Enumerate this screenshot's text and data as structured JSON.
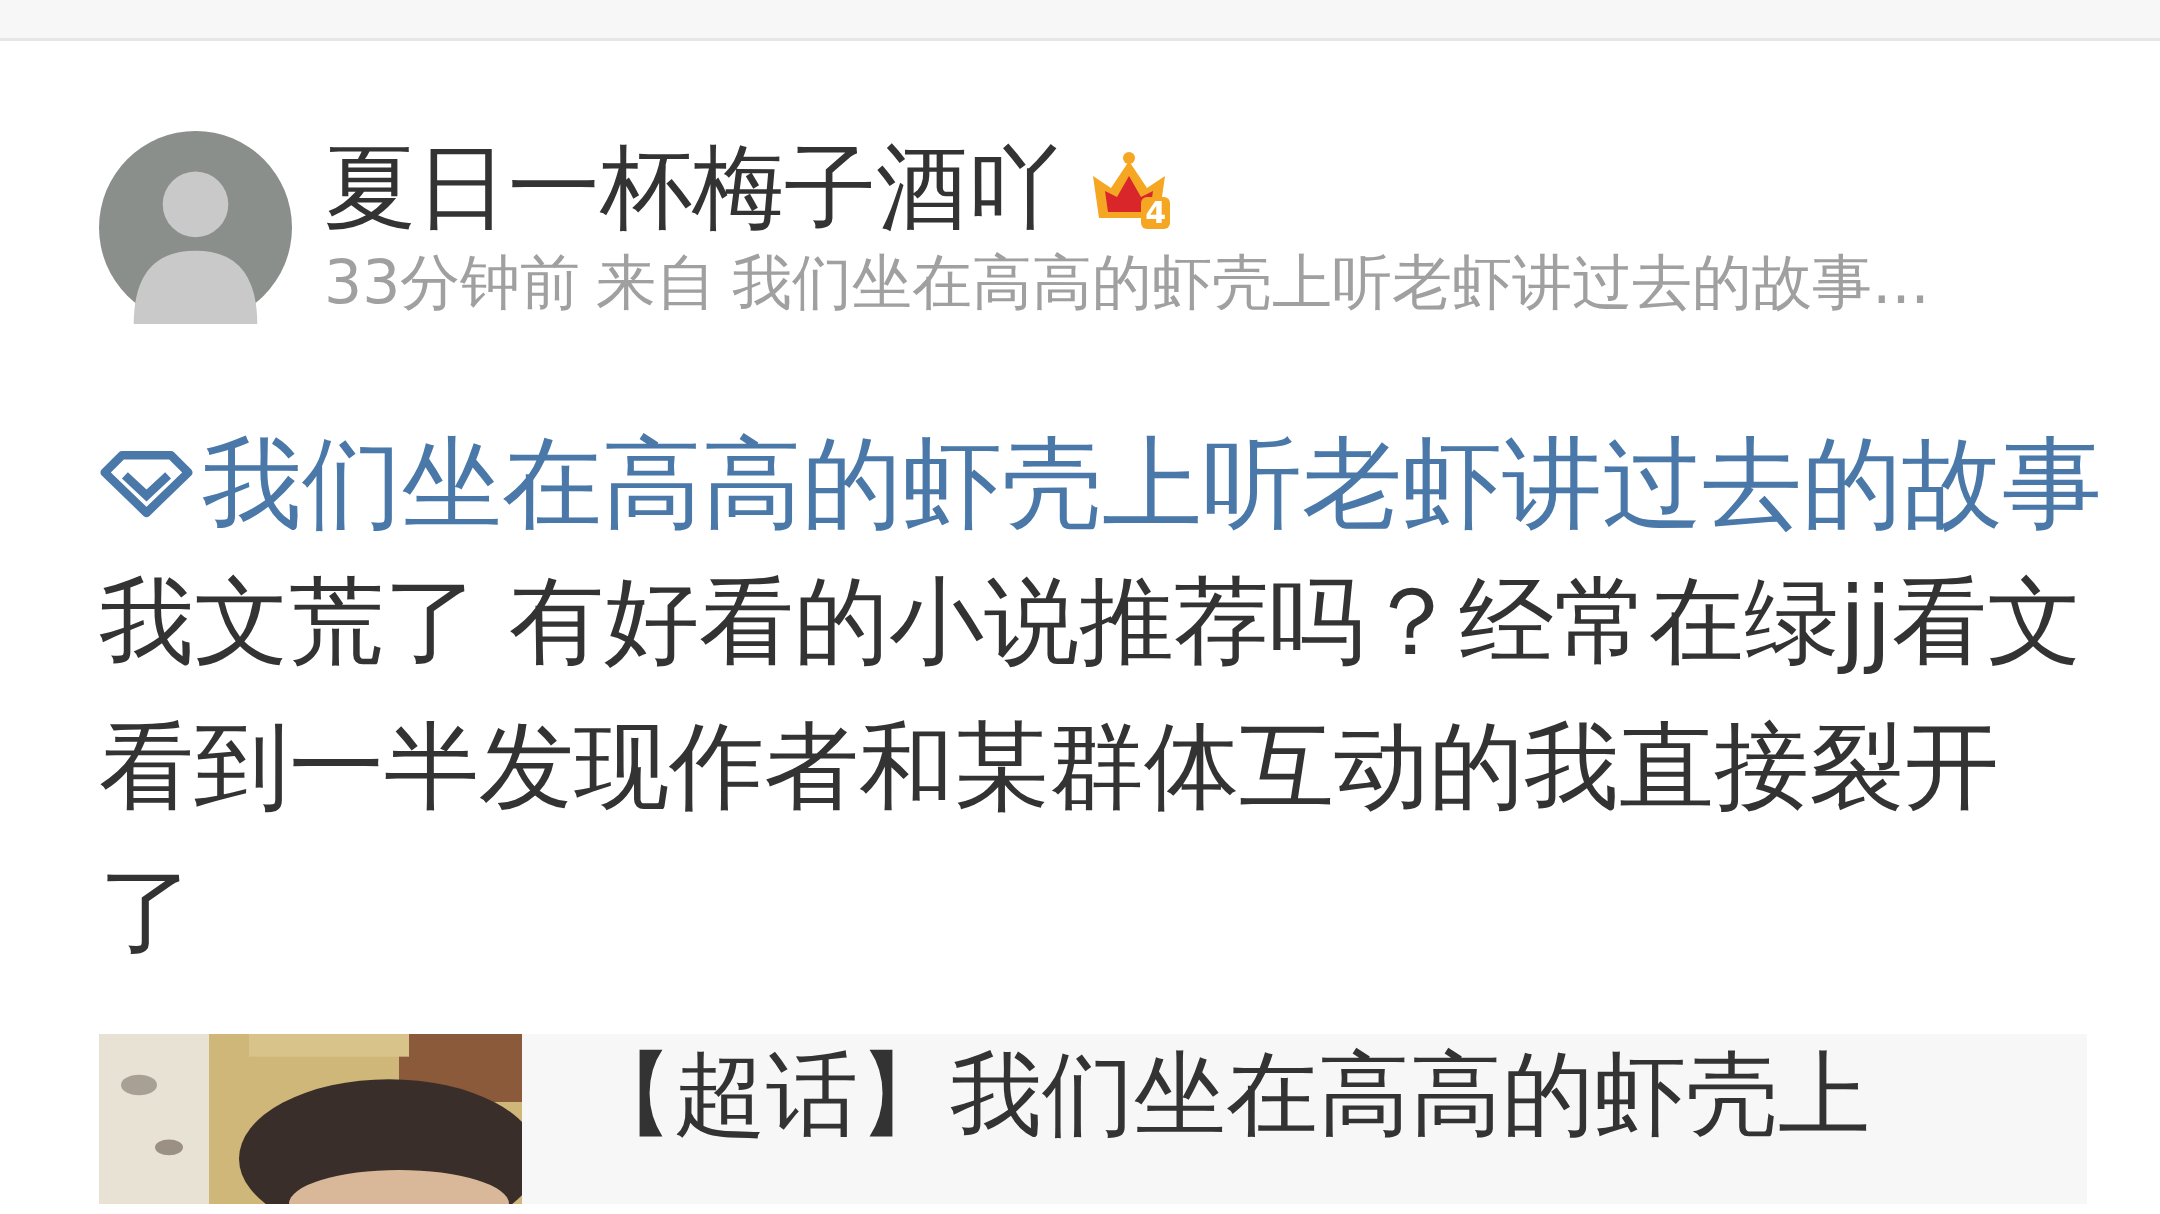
{
  "post": {
    "author": {
      "name": "夏日一杯梅子酒吖",
      "vip_level": "4"
    },
    "meta": {
      "time": "33分钟前",
      "source_prefix": "来自",
      "source": "我们坐在高高的虾壳上听老虾讲过去的故事..."
    },
    "topic": "我们坐在高高的虾壳上听老虾讲过去的故事",
    "text": "我文荒了 有好看的小说推荐吗？经常在绿jj看文看到一半发现作者和某群体互动的我直接裂开了",
    "card": {
      "title": "【超话】我们坐在高高的虾壳上"
    }
  }
}
